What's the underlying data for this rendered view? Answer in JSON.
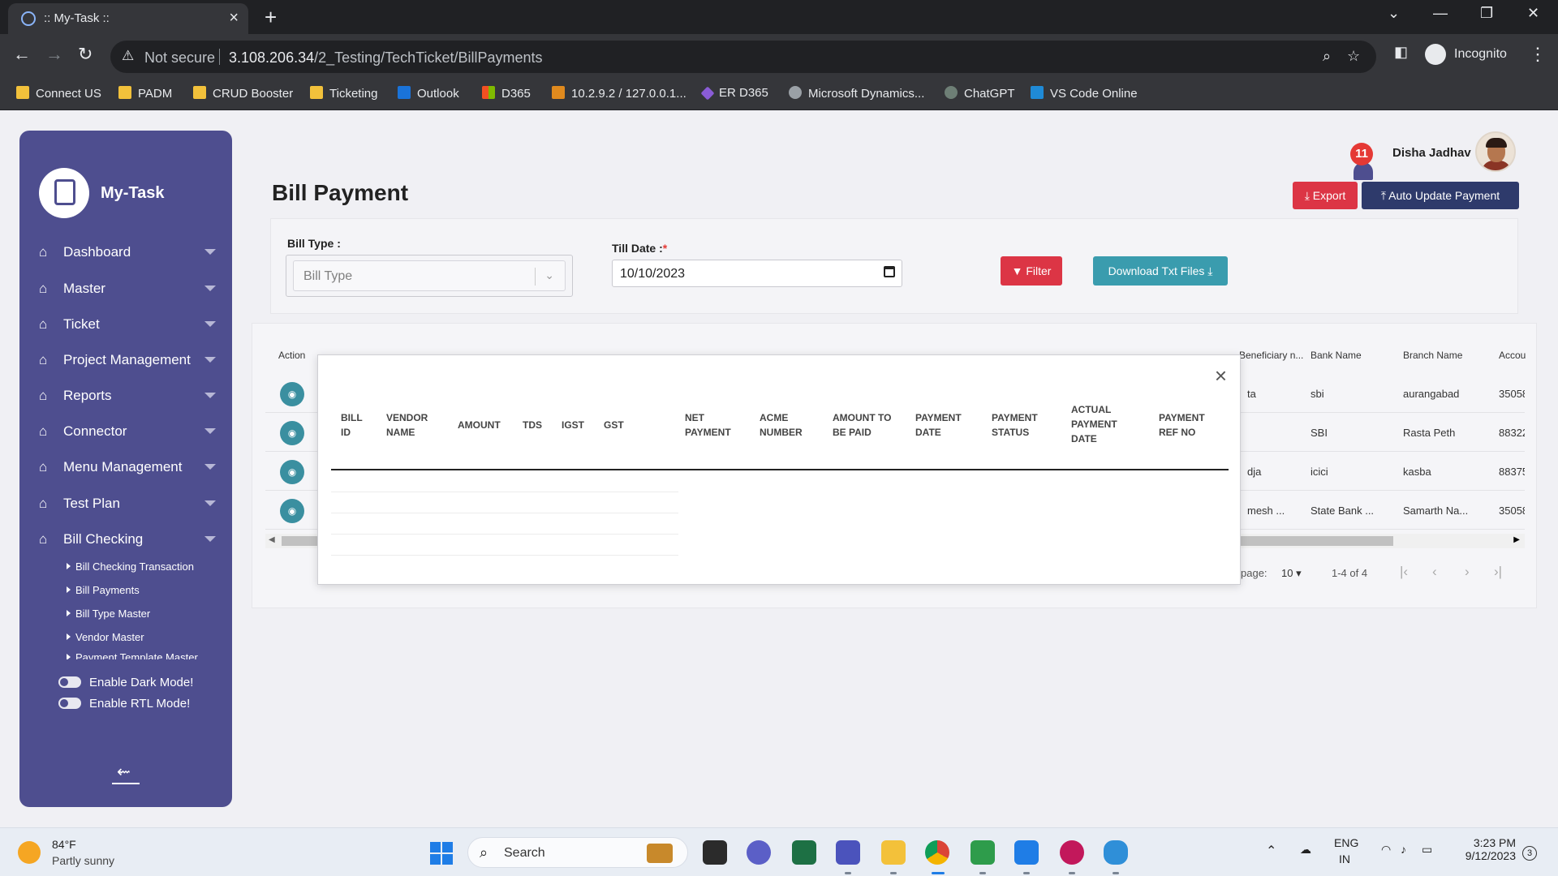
{
  "browser": {
    "tab_title": ":: My-Task ::",
    "url_warning": "Not secure",
    "url_host": "3.108.206.34",
    "url_path": "/2_Testing/TechTicket/BillPayments",
    "profile": "Incognito",
    "bookmarks": [
      "Connect US",
      "PADM",
      "CRUD Booster",
      "Ticketing",
      "Outlook",
      "D365",
      "10.2.9.2 / 127.0.0.1...",
      "ER D365",
      "Microsoft Dynamics...",
      "ChatGPT",
      "VS Code Online"
    ]
  },
  "sidebar": {
    "brand": "My-Task",
    "nav": [
      "Dashboard",
      "Master",
      "Ticket",
      "Project Management",
      "Reports",
      "Connector",
      "Menu Management",
      "Test Plan",
      "Bill Checking"
    ],
    "sub": [
      "Bill Checking Transaction",
      "Bill Payments",
      "Bill Type Master",
      "Vendor Master",
      "Payment Template Master"
    ],
    "dark_mode": "Enable Dark Mode!",
    "rtl_mode": "Enable RTL Mode!"
  },
  "header": {
    "notification_count": "11",
    "user_name": "Disha Jadhav"
  },
  "page": {
    "title": "Bill Payment",
    "export_label": "Export",
    "auto_update_label": "Auto Update Payment",
    "bill_type_label": "Bill Type :",
    "bill_type_placeholder": "Bill Type",
    "till_date_label": "Till Date :",
    "till_date_required": "*",
    "till_date_value": "10/10/2023",
    "filter_label": "Filter",
    "download_label": "Download Txt Files"
  },
  "table": {
    "headers": [
      "Action",
      "Beneficiary n...",
      "Bank Name",
      "Branch Name",
      "Accou"
    ],
    "rows": [
      {
        "beneficiary": "ta",
        "bank": "sbi",
        "branch": "aurangabad",
        "account": "35058"
      },
      {
        "beneficiary": "",
        "bank": "SBI",
        "branch": "Rasta Peth",
        "account": "88322"
      },
      {
        "beneficiary": "dja",
        "bank": "icici",
        "branch": "kasba",
        "account": "88375"
      },
      {
        "beneficiary": "mesh ...",
        "bank": "State Bank ...",
        "branch": "Samarth Na...",
        "account": "35058"
      }
    ],
    "rows_per_page_label": "page:",
    "rows_per_page": "10",
    "range": "1-4 of 4"
  },
  "modal": {
    "headers": [
      "BILL ID",
      "VENDOR NAME",
      "AMOUNT",
      "TDS",
      "IGST",
      "GST",
      "NET PAYMENT",
      "ACME NUMBER",
      "AMOUNT TO BE PAID",
      "PAYMENT DATE",
      "PAYMENT STATUS",
      "ACTUAL PAYMENT DATE",
      "PAYMENT REF NO"
    ]
  },
  "taskbar": {
    "temp": "84°F",
    "condition": "Partly sunny",
    "search": "Search",
    "lang": "ENG",
    "region": "IN",
    "time": "3:23 PM",
    "date": "9/12/2023",
    "notif_count": "3"
  }
}
